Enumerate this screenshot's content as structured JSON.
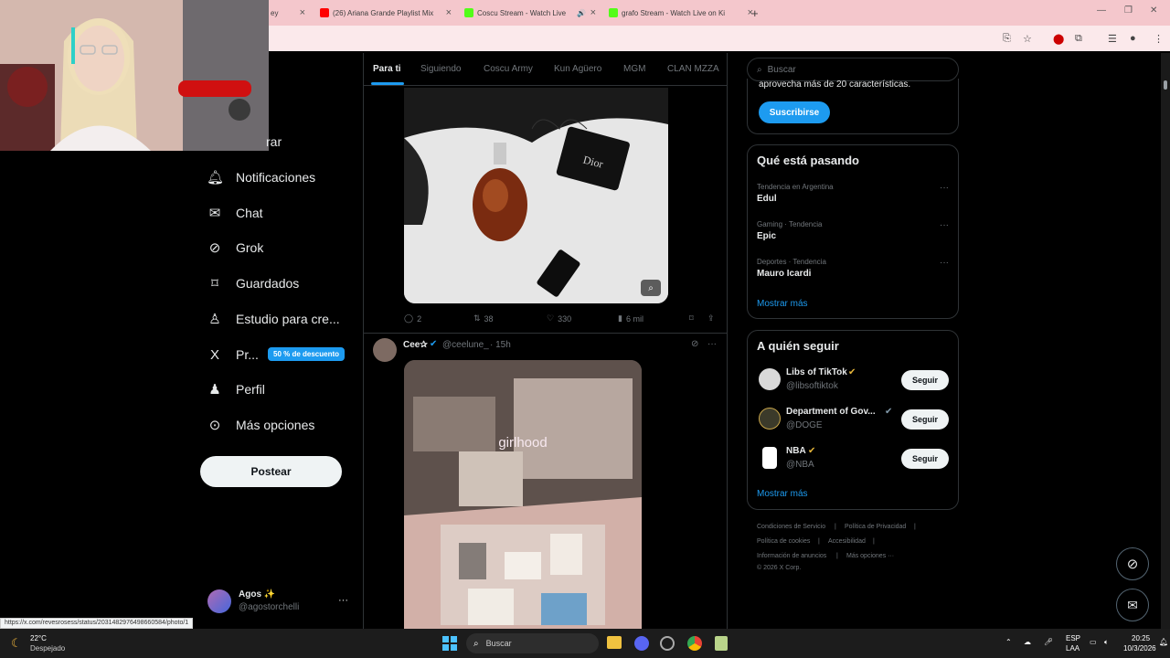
{
  "browser": {
    "tabs": [
      {
        "label": "ey",
        "favicon_color": "#ffffff"
      },
      {
        "label": "(26) Ariana Grande Playlist Mix",
        "favicon_color": "#ff0000"
      },
      {
        "label": "Coscu Stream - Watch Live",
        "favicon_color": "#53fc18"
      },
      {
        "label": "grafo Stream - Watch Live on Ki",
        "favicon_color": "#53fc18"
      }
    ],
    "new_tab": "+"
  },
  "webcam": {
    "caption": ""
  },
  "left_nav": {
    "partial_label": "rar",
    "items": [
      {
        "label": "Notificaciones",
        "icon": "bell-icon",
        "glyph": "🔔"
      },
      {
        "label": "Chat",
        "icon": "mail-icon",
        "glyph": "✉"
      },
      {
        "label": "Grok",
        "icon": "grok-icon",
        "glyph": "⊘"
      },
      {
        "label": "Guardados",
        "icon": "bookmark-icon",
        "glyph": "🔖"
      },
      {
        "label": "Estudio para cre...",
        "icon": "studio-icon",
        "glyph": "♙"
      },
      {
        "label": "Pr...",
        "icon": "x-logo-icon",
        "glyph": "𝕏"
      },
      {
        "label": "Perfil",
        "icon": "person-icon",
        "glyph": "👤"
      },
      {
        "label": "Más opciones",
        "icon": "more-circle-icon",
        "glyph": "⊙"
      }
    ],
    "premium_badge": "50 % de descuento",
    "post_button": "Postear",
    "account": {
      "name": "Agos ✨",
      "handle": "@agostorchelli",
      "more": "···"
    }
  },
  "feed": {
    "tabs": [
      "Para ti",
      "Siguiendo",
      "Coscu Army",
      "Kun Agüero",
      "MGM",
      "CLAN MZZA"
    ],
    "post1": {
      "image_text": "Dior",
      "actions": {
        "replies": "2",
        "reposts": "38",
        "likes": "330",
        "views": "6 mil"
      }
    },
    "post2": {
      "name": "Cee✰",
      "handle": "@ceelune_",
      "time": "· 15h",
      "image_caption": "girlhood"
    }
  },
  "right": {
    "search_placeholder": "Buscar",
    "premium": {
      "text": "aprovecha más de 20 características.",
      "button": "Suscribirse"
    },
    "trends": {
      "title": "Qué está pasando",
      "items": [
        {
          "meta": "Tendencia en Argentina",
          "name": "Edul"
        },
        {
          "meta": "Gaming · Tendencia",
          "name": "Epic"
        },
        {
          "meta": "Deportes · Tendencia",
          "name": "Mauro Icardi"
        }
      ],
      "show_more": "Mostrar más"
    },
    "follow": {
      "title": "A quién seguir",
      "items": [
        {
          "name": "Libs of TikTok",
          "handle": "@libsoftiktok",
          "button": "Seguir",
          "avatar_color": "#d9d9d9"
        },
        {
          "name": "Department of Gov...",
          "handle": "@DOGE",
          "button": "Seguir",
          "avatar_color": "#3b3a2a"
        },
        {
          "name": "NBA",
          "handle": "@NBA",
          "button": "Seguir",
          "avatar_color": "#ffffff"
        }
      ],
      "show_more": "Mostrar más"
    },
    "footer": [
      "Condiciones de Servicio",
      "|",
      "Política de Privacidad",
      "|",
      "Política de cookies",
      "|",
      "Accesibilidad",
      "|",
      "Información de anuncios",
      "|",
      "Más opciones ···",
      "© 2026 X Corp."
    ]
  },
  "status_url": "https://x.com/revesrosess/status/2031482976498660584/photo/1",
  "taskbar": {
    "weather_temp": "22°C",
    "weather_desc": "Despejado",
    "search": "Buscar",
    "lang_top": "ESP",
    "lang_bottom": "LAA",
    "time": "20:25",
    "date": "10/3/2026"
  },
  "colors": {
    "accent": "#1d9bf0",
    "tab_bar": "#f4c7cc",
    "badge": "#1d9bf0"
  }
}
